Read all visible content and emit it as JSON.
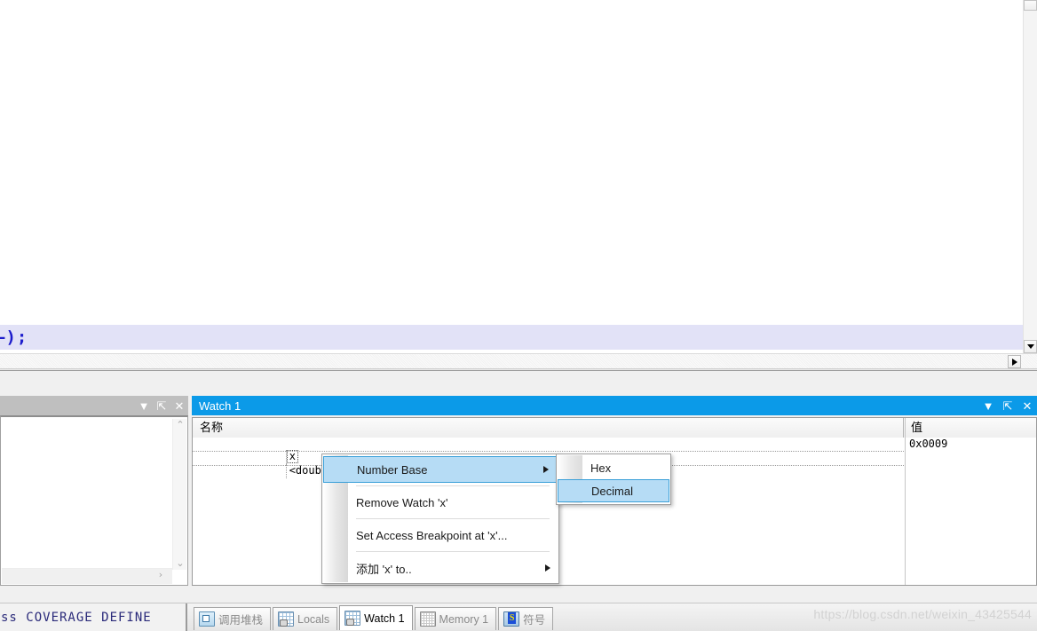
{
  "editor": {
    "code_line": "—);",
    "vscroll_down_icon": "triangle-down-icon",
    "hscroll_right_icon": "triangle-right-icon"
  },
  "left_pane": {
    "titlebar_buttons": [
      {
        "name": "dropdown-icon",
        "glyph": "▼"
      },
      {
        "name": "pin-icon",
        "glyph": "⇱"
      },
      {
        "name": "close-icon",
        "glyph": "✕"
      }
    ],
    "scroll_up_glyph": "⌃",
    "scroll_down_glyph": "⌄",
    "scroll_right_glyph": "›"
  },
  "watch_pane": {
    "title": "Watch 1",
    "titlebar_buttons": [
      {
        "name": "dropdown-icon",
        "glyph": "▼"
      },
      {
        "name": "pin-icon",
        "glyph": "⇱"
      },
      {
        "name": "close-icon",
        "glyph": "✕"
      }
    ],
    "columns": [
      {
        "key": "name",
        "label": "名称"
      },
      {
        "key": "value",
        "label": "值"
      }
    ],
    "rows": [
      {
        "name": "x",
        "value": "0x0009",
        "selected": true
      },
      {
        "name": "<double-click",
        "value": "",
        "selected": false
      }
    ]
  },
  "context_menu": {
    "items": [
      {
        "label": "Number Base",
        "has_submenu": true,
        "highlighted": true,
        "separator_after": true
      },
      {
        "label": "Remove Watch 'x'",
        "has_submenu": false,
        "highlighted": false,
        "separator_after": true
      },
      {
        "label": "Set Access Breakpoint at 'x'...",
        "has_submenu": false,
        "highlighted": false,
        "separator_after": true
      },
      {
        "label": "添加 'x' to..",
        "has_submenu": true,
        "highlighted": false,
        "separator_after": false
      }
    ]
  },
  "submenu": {
    "items": [
      {
        "label": "Hex",
        "highlighted": false
      },
      {
        "label": "Decimal",
        "highlighted": true
      }
    ]
  },
  "bottom_bar": {
    "status_text": "ss COVERAGE DEFINE",
    "tabs": [
      {
        "label": "调用堆栈",
        "icon": "callstack-icon",
        "active": false
      },
      {
        "label": "Locals",
        "icon": "locals-grid-icon",
        "active": false
      },
      {
        "label": "Watch 1",
        "icon": "watch-grid-icon",
        "active": true
      },
      {
        "label": "Memory 1",
        "icon": "memory-grid-icon",
        "active": false
      },
      {
        "label": "符号",
        "icon": "symbol-icon",
        "active": false
      }
    ],
    "watermark": "https://blog.csdn.net/weixin_43425544"
  },
  "colors": {
    "active_titlebar": "#0b9ae8",
    "inactive_titlebar": "#bfbfbf",
    "menu_highlight": "#b6dcf5",
    "menu_highlight_border": "#3a9fd8",
    "current_line": "#e2e2f7",
    "code_text": "#1c1ccc",
    "status_text": "#2a2a7a"
  }
}
